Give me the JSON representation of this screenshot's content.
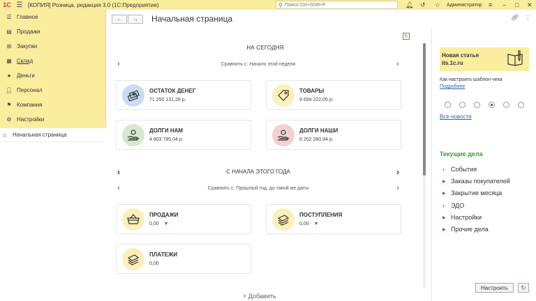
{
  "topbar": {
    "logo": "1С",
    "title": "[КОПИЯ] Розница, редакция 3.0  (1С:Предприятие)",
    "search_placeholder": "Поиск Ctrl+Shift+F",
    "user": "Администратор"
  },
  "sidebar": {
    "items": [
      {
        "label": "Главное",
        "icon": "menu-icon"
      },
      {
        "label": "Продажи",
        "icon": "sales-icon"
      },
      {
        "label": "Закупки",
        "icon": "purchase-icon"
      },
      {
        "label": "Склад",
        "icon": "warehouse-icon"
      },
      {
        "label": "Деньги",
        "icon": "money-icon"
      },
      {
        "label": "Персонал",
        "icon": "staff-icon"
      },
      {
        "label": "Компания",
        "icon": "flag-icon"
      },
      {
        "label": "Настройки",
        "icon": "gear-icon"
      }
    ],
    "open_pages": [
      {
        "label": "Начальная страница",
        "icon": "home-icon"
      }
    ]
  },
  "header": {
    "back": "←",
    "forward": "→",
    "title": "Начальная страница"
  },
  "today": {
    "title": "НА СЕГОДНЯ",
    "compare": "Сравнить с: Начало этой недели",
    "cards": [
      {
        "name": "ОСТАТОК ДЕНЕГ",
        "value": "71 250 131,28 р."
      },
      {
        "name": "ТОВАРЫ",
        "value": "9 694 222,05 р."
      },
      {
        "name": "ДОЛГИ НАМ",
        "value": "4 803 785,04 р."
      },
      {
        "name": "ДОЛГИ НАШИ",
        "value": "8 202 280,94 р."
      }
    ]
  },
  "year": {
    "title": "С НАЧАЛА ЭТОГО ГОДА",
    "compare": "Сравнить с: Прошлый год, до такой же даты",
    "cards": [
      {
        "name": "ПРОДАЖИ",
        "value": "0,00"
      },
      {
        "name": "ПОСТУПЛЕНИЯ",
        "value": "0,00"
      },
      {
        "name": "ПЛАТЕЖИ",
        "value": "0,00"
      }
    ]
  },
  "add_label": "+ Добавить",
  "right": {
    "banner_line1": "Новая статья",
    "banner_line2": "its.1c.ru",
    "hint": "Как настроить шаблон чека",
    "more_link": "Подробнее",
    "all_news": "Все новости",
    "current_title": "Текущие дела",
    "current_items": [
      {
        "label": "События",
        "marker": "grey"
      },
      {
        "label": "Заказы покупателей",
        "marker": "red"
      },
      {
        "label": "Закрытие месяца",
        "marker": "red"
      },
      {
        "label": "ЭДО",
        "marker": "grey"
      },
      {
        "label": "Настройки",
        "marker": "red"
      },
      {
        "label": "Прочие дела",
        "marker": "red"
      }
    ],
    "setup_button": "Настроить"
  },
  "colors": {
    "accent_yellow": "#fbed9e",
    "link_blue": "#2a63b8",
    "green_title": "#3b9d3b",
    "red_marker": "#c0392b"
  }
}
